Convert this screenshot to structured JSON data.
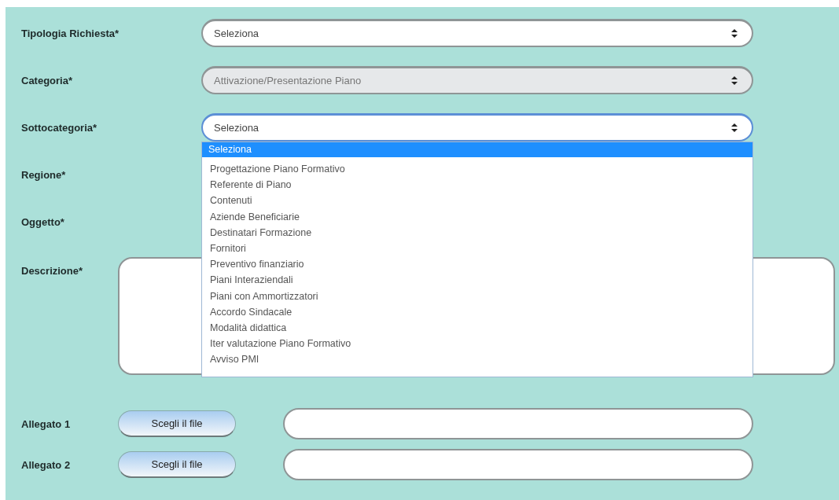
{
  "fields": [
    {
      "label": "Tipologia Richiesta*",
      "kind": "select",
      "value": "Seleziona",
      "disabled": false,
      "open": false
    },
    {
      "label": "Categoria*",
      "kind": "select",
      "value": "Attivazione/Presentazione Piano",
      "disabled": true,
      "open": false
    },
    {
      "label": "Sottocategoria*",
      "kind": "select",
      "value": "Seleziona",
      "disabled": false,
      "open": true,
      "options": [
        {
          "label": "Seleziona",
          "selected": true
        },
        {
          "label": "Progettazione Piano Formativo",
          "selected": false
        },
        {
          "label": "Referente di Piano",
          "selected": false
        },
        {
          "label": "Contenuti",
          "selected": false
        },
        {
          "label": "Aziende Beneficiarie",
          "selected": false
        },
        {
          "label": "Destinatari Formazione",
          "selected": false
        },
        {
          "label": "Fornitori",
          "selected": false
        },
        {
          "label": "Preventivo finanziario",
          "selected": false
        },
        {
          "label": "Piani Interaziendali",
          "selected": false
        },
        {
          "label": "Piani con Ammortizzatori",
          "selected": false
        },
        {
          "label": "Accordo Sindacale",
          "selected": false
        },
        {
          "label": "Modalità didattica",
          "selected": false
        },
        {
          "label": "Iter valutazione Piano Formativo",
          "selected": false
        },
        {
          "label": "Avviso PMI",
          "selected": false
        }
      ]
    },
    {
      "label": "Regione*",
      "kind": "covered"
    },
    {
      "label": "Oggetto*",
      "kind": "covered"
    },
    {
      "label": "Descrizione*",
      "kind": "textarea"
    },
    {
      "label": "Allegato 1",
      "kind": "file",
      "button": "Scegli il file"
    },
    {
      "label": "Allegato 2",
      "kind": "file",
      "button": "Scegli il file"
    }
  ]
}
